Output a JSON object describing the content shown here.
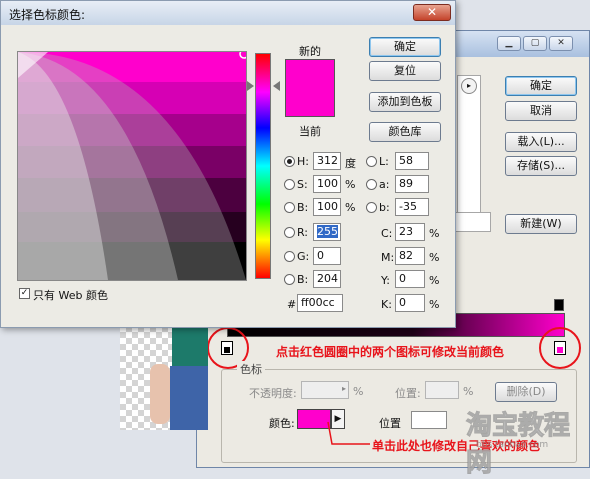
{
  "picker": {
    "title": "选择色标颜色:",
    "close": "✕",
    "new_label": "新的",
    "current_label": "当前",
    "new_color": "#ff00cc",
    "current_color": "#ff00cc",
    "buttons": {
      "ok": "确定",
      "reset": "复位",
      "add_swatch": "添加到色板",
      "color_library": "颜色库"
    },
    "hsb": [
      {
        "label": "H:",
        "value": "312",
        "unit": "度"
      },
      {
        "label": "S:",
        "value": "100",
        "unit": "%"
      },
      {
        "label": "B:",
        "value": "100",
        "unit": "%"
      }
    ],
    "rgb": [
      {
        "label": "R:",
        "value": "255"
      },
      {
        "label": "G:",
        "value": "0"
      },
      {
        "label": "B:",
        "value": "204"
      }
    ],
    "lab": [
      {
        "label": "L:",
        "value": "58"
      },
      {
        "label": "a:",
        "value": "89"
      },
      {
        "label": "b:",
        "value": "-35"
      }
    ],
    "cmyk": [
      {
        "label": "C:",
        "value": "23",
        "unit": "%"
      },
      {
        "label": "M:",
        "value": "82",
        "unit": "%"
      },
      {
        "label": "Y:",
        "value": "0",
        "unit": "%"
      },
      {
        "label": "K:",
        "value": "0",
        "unit": "%"
      }
    ],
    "hex_label": "#",
    "hex_value": "ff00cc",
    "web_only": "只有 Web 颜色"
  },
  "editor": {
    "buttons": {
      "ok": "确定",
      "cancel": "取消",
      "load": "载入(L)...",
      "save": "存储(S)...",
      "new": "新建(W)",
      "delete": "删除(D)"
    },
    "stops": {
      "group_title": "色标",
      "opacity_label": "不透明度:",
      "location_label": "位置:",
      "percent": "%",
      "color_label": "颜色:",
      "location2_label": "位置",
      "stop_color": "#ff00cc"
    }
  },
  "annotations": {
    "note1": "点击红色圆圈中的两个图标可修改当前颜色",
    "note2": "单击此处也修改自己喜欢的颜色"
  },
  "watermark": {
    "text": "淘宝教程网",
    "url": "bbs.taobao.com"
  }
}
